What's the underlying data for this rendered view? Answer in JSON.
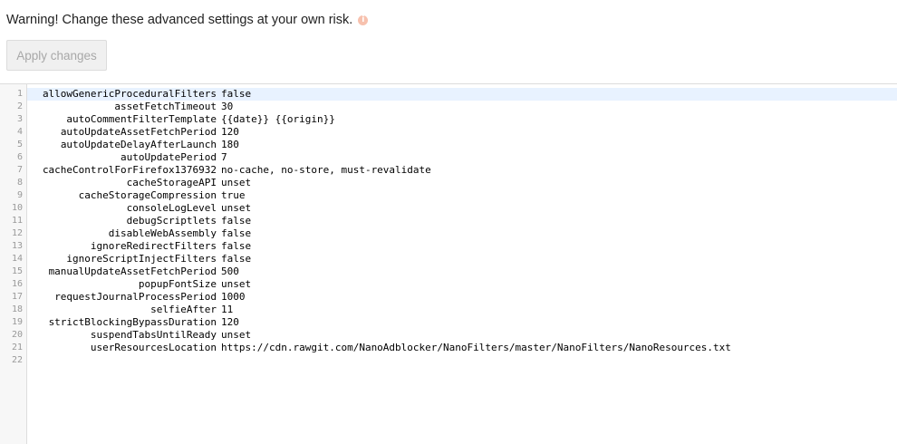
{
  "warning": {
    "text": "Warning! Change these advanced settings at your own risk.",
    "icon": "info-icon"
  },
  "apply_button": {
    "label": "Apply changes",
    "disabled": true
  },
  "editor": {
    "active_line": 1,
    "lines": [
      {
        "num": "1",
        "key": "allowGenericProceduralFilters",
        "value": "false"
      },
      {
        "num": "2",
        "key": "assetFetchTimeout",
        "value": "30"
      },
      {
        "num": "3",
        "key": "autoCommentFilterTemplate",
        "value": "{{date}} {{origin}}"
      },
      {
        "num": "4",
        "key": "autoUpdateAssetFetchPeriod",
        "value": "120"
      },
      {
        "num": "5",
        "key": "autoUpdateDelayAfterLaunch",
        "value": "180"
      },
      {
        "num": "6",
        "key": "autoUpdatePeriod",
        "value": "7"
      },
      {
        "num": "7",
        "key": "cacheControlForFirefox1376932",
        "value": "no-cache, no-store, must-revalidate"
      },
      {
        "num": "8",
        "key": "cacheStorageAPI",
        "value": "unset"
      },
      {
        "num": "9",
        "key": "cacheStorageCompression",
        "value": "true"
      },
      {
        "num": "10",
        "key": "consoleLogLevel",
        "value": "unset"
      },
      {
        "num": "11",
        "key": "debugScriptlets",
        "value": "false"
      },
      {
        "num": "12",
        "key": "disableWebAssembly",
        "value": "false"
      },
      {
        "num": "13",
        "key": "ignoreRedirectFilters",
        "value": "false"
      },
      {
        "num": "14",
        "key": "ignoreScriptInjectFilters",
        "value": "false"
      },
      {
        "num": "15",
        "key": "manualUpdateAssetFetchPeriod",
        "value": "500"
      },
      {
        "num": "16",
        "key": "popupFontSize",
        "value": "unset"
      },
      {
        "num": "17",
        "key": "requestJournalProcessPeriod",
        "value": "1000"
      },
      {
        "num": "18",
        "key": "selfieAfter",
        "value": "11"
      },
      {
        "num": "19",
        "key": "strictBlockingBypassDuration",
        "value": "120"
      },
      {
        "num": "20",
        "key": "suspendTabsUntilReady",
        "value": "unset"
      },
      {
        "num": "21",
        "key": "userResourcesLocation",
        "value": "https://cdn.rawgit.com/NanoAdblocker/NanoFilters/master/NanoFilters/NanoResources.txt"
      },
      {
        "num": "22",
        "key": "",
        "value": ""
      }
    ]
  }
}
